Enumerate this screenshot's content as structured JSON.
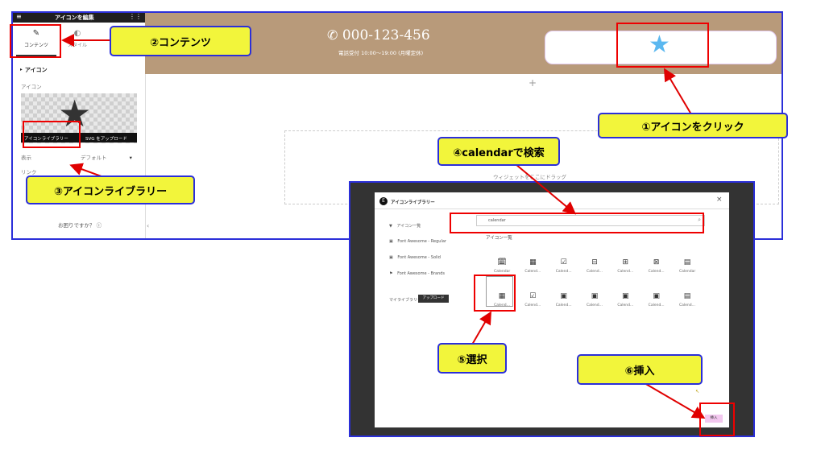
{
  "editor_panel": {
    "title": "アイコンを編集",
    "tab_content": "コンテンツ",
    "tab_style": "スタイル",
    "section_icon": "アイコン",
    "label_icon": "アイコン",
    "btn_icon_library": "アイコンライブラリー",
    "btn_svg_upload": "SVG をアップロード",
    "label_view": "表示",
    "view_value": "デフォルト",
    "label_link": "リンク",
    "help_text": "お困りですか？"
  },
  "page_header": {
    "phone": "000-123-456",
    "hours": "電話受付 10:00〜19:00 (月曜定休)",
    "drop_text": "ウィジェットをここにドラッグ",
    "bg_color": "#b89a7a",
    "star_color": "#5bb8f0"
  },
  "modal": {
    "title": "アイコンライブラリー",
    "search_value": "calendar",
    "all_icons_label": "アイコン一覧",
    "library_items": [
      "アイコン一覧",
      "Font Awesome - Regular",
      "Font Awesome - Solid",
      "Font Awesome - Brands"
    ],
    "my_library": "マイライブラリー",
    "upload_button": "アップロード",
    "section_label": "アイコン一覧",
    "icons_row1": [
      "Calendar",
      "Calend...",
      "Calend...",
      "Calend...",
      "Calend...",
      "Calend...",
      "Calendar"
    ],
    "icons_row2": [
      "Calend...",
      "Calend...",
      "Calend...",
      "Calend...",
      "Calend...",
      "Calend...",
      "Calend..."
    ],
    "insert_button": "挿入"
  },
  "annotations": {
    "step1": "①アイコンをクリック",
    "step2": "②コンテンツ",
    "step3": "③アイコンライブラリー",
    "step4": "④calendarで検索",
    "step5": "⑤選択",
    "step6": "⑥挿入",
    "callout_color": "#f2f53b",
    "border_color": "#2b2fd9",
    "arrow_color": "#e00000"
  }
}
